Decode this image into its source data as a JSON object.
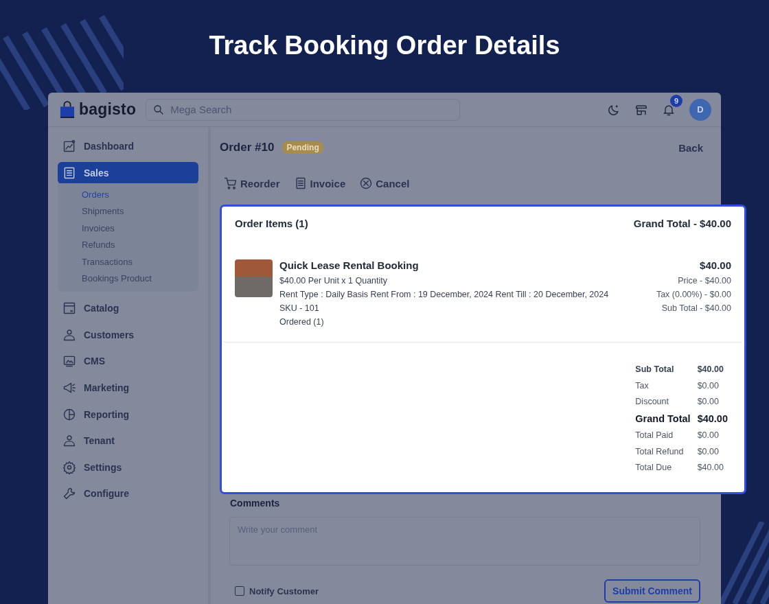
{
  "headline": "Track Booking Order Details",
  "header": {
    "logo": "bagisto",
    "search": {
      "placeholder": "Mega Search"
    },
    "notification_count": "9",
    "avatar": "D"
  },
  "sidebar": {
    "items": [
      {
        "label": "Dashboard",
        "kind": "dashboard",
        "selected": false
      },
      {
        "label": "Sales",
        "kind": "sales",
        "selected": true,
        "expanded": true,
        "children": [
          {
            "label": "Orders",
            "selected": true
          },
          {
            "label": "Shipments",
            "selected": false
          },
          {
            "label": "Invoices",
            "selected": false
          },
          {
            "label": "Refunds",
            "selected": false
          },
          {
            "label": "Transactions",
            "selected": false
          },
          {
            "label": "Bookings Product",
            "selected": false
          }
        ]
      },
      {
        "label": "Catalog",
        "kind": "catalog",
        "selected": false
      },
      {
        "label": "Customers",
        "kind": "person",
        "selected": false
      },
      {
        "label": "CMS",
        "kind": "cms",
        "selected": false
      },
      {
        "label": "Marketing",
        "kind": "megaphone",
        "selected": false
      },
      {
        "label": "Reporting",
        "kind": "chart",
        "selected": false
      },
      {
        "label": "Tenant",
        "kind": "person",
        "selected": false
      },
      {
        "label": "Settings",
        "kind": "gear",
        "selected": false
      },
      {
        "label": "Configure",
        "kind": "wrench",
        "selected": false
      }
    ]
  },
  "order": {
    "title": "Order #10",
    "status": "Pending",
    "back": "Back",
    "actions": [
      {
        "label": "Reorder",
        "kind": "cart"
      },
      {
        "label": "Invoice",
        "kind": "document"
      },
      {
        "label": "Cancel",
        "kind": "cancel"
      }
    ]
  },
  "order_items": {
    "title": "Order Items (1)",
    "grand_total": "Grand Total - $40.00",
    "items": [
      {
        "name": "Quick Lease Rental Booking",
        "unit_line": "$40.00 Per Unit x 1 Quantity",
        "rent_line": "Rent Type : Daily Basis Rent From : 19 December, 2024 Rent Till : 20 December, 2024",
        "sku": "SKU - 101",
        "ordered": "Ordered (1)",
        "total": "$40.00",
        "price": "Price - $40.00",
        "tax": "Tax (0.00%) - $0.00",
        "sub_total": "Sub Total - $40.00"
      }
    ],
    "summary": [
      {
        "label": "Sub Total",
        "value": "$40.00",
        "kind": "subtotal"
      },
      {
        "label": "Tax",
        "value": "$0.00",
        "kind": "line"
      },
      {
        "label": "Discount",
        "value": "$0.00",
        "kind": "line"
      },
      {
        "label": "Grand Total",
        "value": "$40.00",
        "kind": "grand"
      },
      {
        "label": "Total Paid",
        "value": "$0.00",
        "kind": "line"
      },
      {
        "label": "Total Refund",
        "value": "$0.00",
        "kind": "line"
      },
      {
        "label": "Total Due",
        "value": "$40.00",
        "kind": "line"
      }
    ]
  },
  "comments": {
    "title": "Comments",
    "placeholder": "Write your comment",
    "notify": {
      "label": "Notify Customer",
      "checked": false
    },
    "submit": "Submit Comment"
  }
}
